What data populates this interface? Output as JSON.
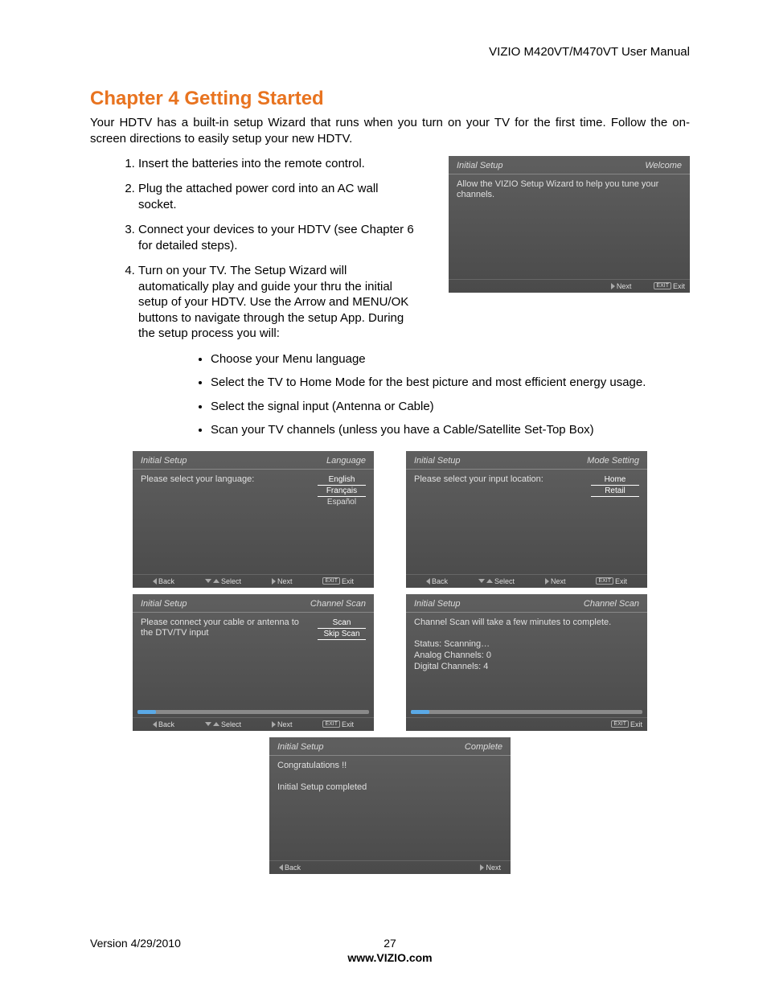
{
  "header": {
    "doc_title": "VIZIO M420VT/M470VT User Manual"
  },
  "chapter": {
    "title": "Chapter 4 Getting Started"
  },
  "intro": "Your HDTV has a built-in setup Wizard that runs when you turn on your TV for the first time. Follow the on-screen directions to easily setup your new HDTV.",
  "steps": [
    "Insert the batteries into the remote control.",
    "Plug the attached power cord into an AC wall socket.",
    "Connect your devices to your HDTV (see Chapter 6 for detailed steps).",
    "Turn on your TV. The Setup Wizard will automatically play and guide your thru the initial setup of your HDTV. Use the Arrow and MENU/OK buttons to navigate through the setup App. During the setup process you will:"
  ],
  "bullets": [
    "Choose your Menu language",
    "Select the TV to Home Mode for the best picture and most efficient energy usage.",
    "Select the signal input (Antenna or Cable)",
    "Scan your TV channels (unless you have a Cable/Satellite Set-Top Box)"
  ],
  "nav": {
    "back": "Back",
    "select": "Select",
    "next": "Next",
    "exit": "Exit",
    "exit_key": "EXIT"
  },
  "panels": {
    "welcome": {
      "heading": "Initial Setup",
      "tag": "Welcome",
      "body": "Allow the VIZIO Setup Wizard to help you tune your channels."
    },
    "language": {
      "heading": "Initial Setup",
      "tag": "Language",
      "body": "Please select your language:",
      "options": [
        "English",
        "Français",
        "Español"
      ]
    },
    "mode": {
      "heading": "Initial Setup",
      "tag": "Mode Setting",
      "body": "Please select your input location:",
      "options": [
        "Home",
        "Retail"
      ]
    },
    "chanscan1": {
      "heading": "Initial Setup",
      "tag": "Channel Scan",
      "body": "Please connect your cable or antenna to the DTV/TV input",
      "options": [
        "Scan",
        "Skip Scan"
      ]
    },
    "chanscan2": {
      "heading": "Initial Setup",
      "tag": "Channel Scan",
      "body1": "Channel Scan will take a few minutes to complete.",
      "status": "Status: Scanning…",
      "analog": "Analog Channels: 0",
      "digital": "Digital Channels: 4"
    },
    "complete": {
      "heading": "Initial Setup",
      "tag": "Complete",
      "body1": "Congratulations !!",
      "body2": "Initial Setup completed"
    }
  },
  "footer": {
    "version": "Version 4/29/2010",
    "page": "27",
    "site": "www.VIZIO.com"
  }
}
